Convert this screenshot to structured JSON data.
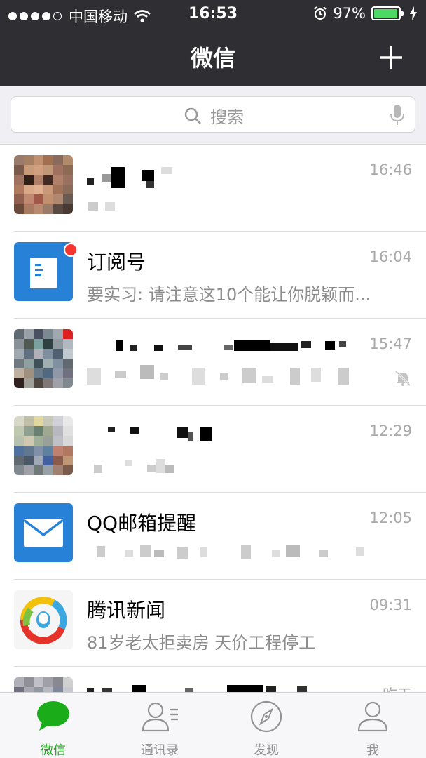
{
  "status_bar": {
    "carrier": "中国移动",
    "time": "16:53",
    "battery": "97%",
    "battery_level": 0.97,
    "icons": [
      "signal-dots",
      "wifi-icon",
      "alarm-icon",
      "battery-icon",
      "charging-bolt-icon"
    ]
  },
  "nav": {
    "title": "微信",
    "add_icon": "plus-icon"
  },
  "search": {
    "placeholder": "搜索",
    "icons": [
      "search-icon",
      "microphone-icon"
    ]
  },
  "chats": [
    {
      "name": "",
      "preview": "",
      "time": "16:46"
    },
    {
      "name": "订阅号",
      "preview": "要实习: 请注意这10个能让你脱颖而...",
      "time": "16:04"
    },
    {
      "name": "",
      "preview": "",
      "time": "15:47"
    },
    {
      "name": "",
      "preview": "",
      "time": "12:29"
    },
    {
      "name": "QQ邮箱提醒",
      "preview": "",
      "time": "12:05"
    },
    {
      "name": "腾讯新闻",
      "preview": "81岁老太拒卖房 天价工程停工",
      "time": "09:31"
    },
    {
      "name": "",
      "preview": "",
      "time": "昨天"
    }
  ],
  "tabs": [
    {
      "label": "微信",
      "icon": "chat-bubble-icon",
      "active": true
    },
    {
      "label": "通讯录",
      "icon": "contacts-icon",
      "active": false
    },
    {
      "label": "发现",
      "icon": "compass-icon",
      "active": false
    },
    {
      "label": "我",
      "icon": "person-icon",
      "active": false
    }
  ],
  "colors": {
    "header_bg": "#2e2e33",
    "accent_green": "#1aad19",
    "badge_red": "#f43530",
    "blue_icon": "#2782d7"
  }
}
